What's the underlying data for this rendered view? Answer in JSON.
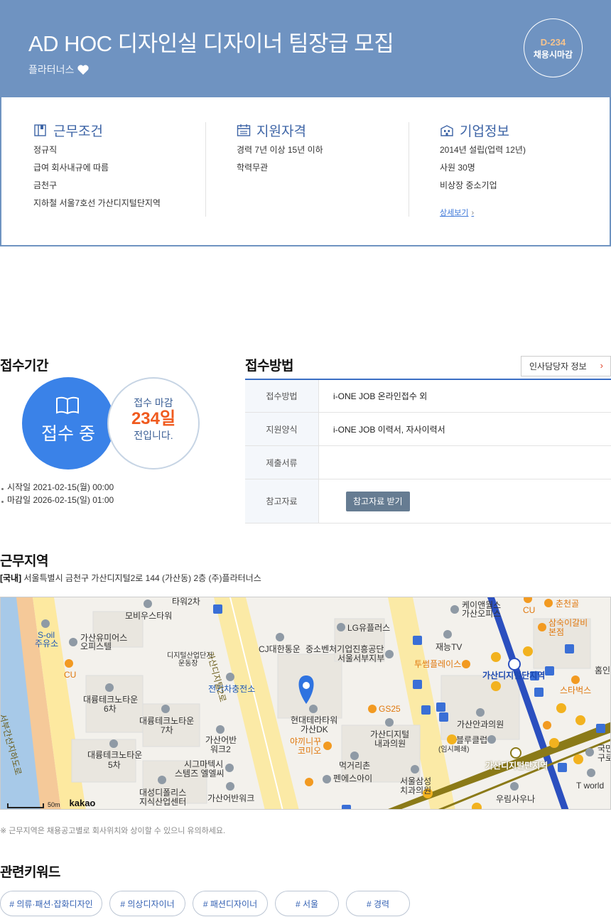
{
  "header": {
    "title": "AD HOC 디자인실 디자이너 팀장급 모집",
    "company": "플라터너스",
    "dday": "D-234",
    "dday_sub": "채용시마감"
  },
  "conditions": {
    "title": "근무조건",
    "items": [
      "정규직",
      "급여 회사내규에 따름",
      "금천구",
      "지하철 서울7호선 가산디지털단지역"
    ]
  },
  "qualifications": {
    "title": "지원자격",
    "items": [
      "경력 7년 이상 15년 이하",
      "학력무관"
    ]
  },
  "company_info": {
    "title": "기업정보",
    "items": [
      "2014년 설립(업력 12년)",
      "사원 30명",
      "비상장 중소기업"
    ],
    "more_link": "상세보기"
  },
  "period": {
    "title": "접수기간",
    "status": "접수 중",
    "deadline_label": "접수 마감",
    "days": "234일",
    "days_suffix": "전입니다.",
    "start": "시작일 2021-02-15(월) 00:00",
    "end": "마감일 2026-02-15(일) 01:00"
  },
  "apply": {
    "title": "접수방법",
    "hr_button": "인사담당자 정보",
    "rows": [
      {
        "label": "접수방법",
        "value": "i-ONE JOB 온라인접수 외"
      },
      {
        "label": "지원양식",
        "value": "i-ONE JOB 이력서, 자사이력서"
      },
      {
        "label": "제출서류",
        "value": ""
      },
      {
        "label": "참고자료",
        "button": "참고자료 받기"
      }
    ]
  },
  "location": {
    "title": "근무지역",
    "region_tag": "[국내]",
    "address": "서울특별시 금천구 가산디지털2로 144 (가산동) 2층 (주)플라터너스",
    "scale": "50m",
    "map_brand": "kakao",
    "notice": "※ 근무지역은 채용공고별로 회사위치와 상이할 수 있으니 유의하세요.",
    "map_labels": [
      "타워2차",
      "모비우스타워",
      "케이앤월스",
      "가산오피스",
      "춘천골",
      "삼숙이갈비",
      "본점",
      "S-oil",
      "주유소",
      "가산유미어스",
      "오피스텔",
      "LG유플러스",
      "재능TV",
      "CU",
      "디지털산업단지",
      "운동장",
      "CJ대한통운",
      "중소벤처기업진흥공단",
      "서울서부지부",
      "투썸플레이스",
      "가산디지털단지역",
      "홈인",
      "대륭테크노타운",
      "6차",
      "전기차충전소",
      "스타벅스",
      "대륭테크노타운",
      "7차",
      "현대테라타워",
      "가산DK",
      "GS25",
      "가산안과의원",
      "가산어반",
      "워크2",
      "가산디지털",
      "내과의원",
      "블루클럽",
      "(임시폐쇄)",
      "국민",
      "구로",
      "대륭테크노타운",
      "5차",
      "시그마텍시",
      "스템즈 엘엘씨",
      "야끼니꾸",
      "코미오",
      "먹거리촌",
      "펜에스아이",
      "서울삼성",
      "치과의원",
      "가산디지털단지역",
      "T world",
      "대성디폴리스",
      "지식산업센터",
      "가산어반워크",
      "우림사우나",
      "CU",
      "가산디지털2로",
      "서부간선지하도로"
    ]
  },
  "keywords": {
    "title": "관련키워드",
    "items": [
      "# 의류·패션·잡화디자인",
      "# 의상디자이너",
      "# 패션디자이너",
      "# 서울",
      "# 경력"
    ]
  },
  "colors": {
    "header_bg": "#6f93c1",
    "accent_blue": "#3a82e8",
    "accent_orange": "#f05a1e",
    "heading_blue": "#3d64a6"
  }
}
